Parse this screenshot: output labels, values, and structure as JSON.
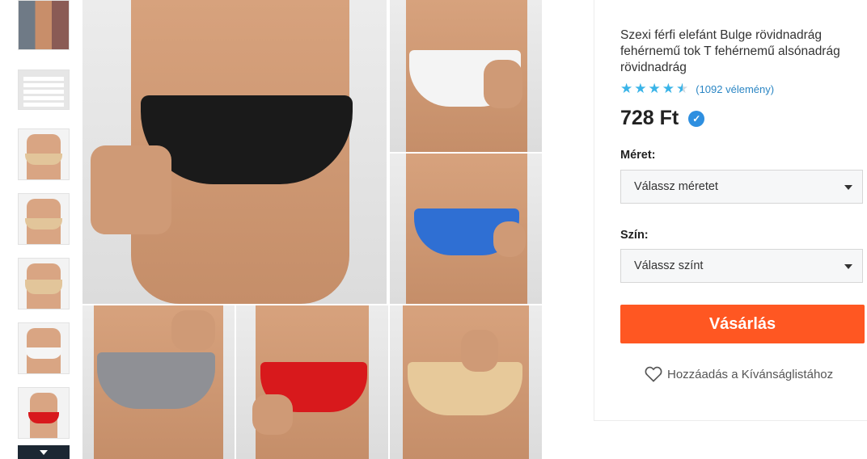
{
  "product": {
    "title": "Szexi férfi elefánt Bulge rövidnadrág fehérnemű tok T fehérnemű alsónadrág rövidnadrág",
    "rating_value": 4.5,
    "reviews_text": "(1092 vélemény)",
    "price": "728 Ft",
    "verified_icon": "verified-check-icon"
  },
  "options": {
    "size_label": "Méret:",
    "size_placeholder": "Válassz méretet",
    "color_label": "Szín:",
    "color_placeholder": "Válassz színt"
  },
  "actions": {
    "buy_label": "Vásárlás",
    "wishlist_label": "Hozzáadás a Kívánságlistához",
    "wishlist_icon": "heart-icon"
  },
  "gallery": {
    "thumbnails": [
      {
        "name": "thumb-collage"
      },
      {
        "name": "thumb-size-chart"
      },
      {
        "name": "thumb-beige-front"
      },
      {
        "name": "thumb-beige-side"
      },
      {
        "name": "thumb-beige-back"
      },
      {
        "name": "thumb-white-front"
      },
      {
        "name": "thumb-red-model"
      }
    ],
    "scroll_icon": "chevron-down-icon",
    "photo_colors": [
      "#1a1a1a",
      "#f4f4f4",
      "#2f6fd3",
      "#8f9095",
      "#d8191c",
      "#e7c99a"
    ]
  },
  "colors": {
    "accent": "#ff5722",
    "stars": "#3ab4e8",
    "link": "#2b86c4",
    "verified": "#2e8fe0"
  }
}
